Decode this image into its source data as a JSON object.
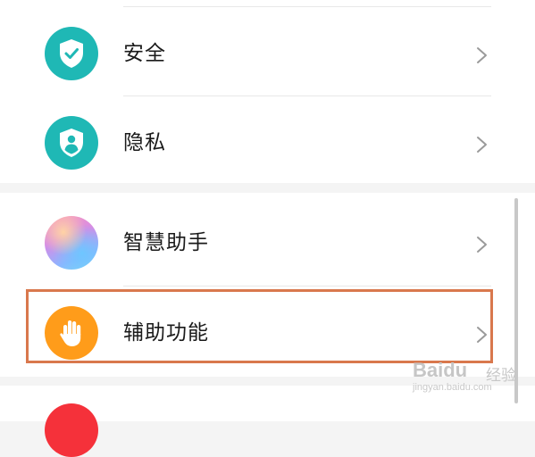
{
  "settings_list": [
    {
      "label": "安全",
      "icon": "shield-check-icon",
      "icon_color": "#1fb8b5"
    },
    {
      "label": "隐私",
      "icon": "shield-user-icon",
      "icon_color": "#1fb8b5"
    },
    {
      "label": "智慧助手",
      "icon": "assistant-orb-icon",
      "icon_color": "gradient"
    },
    {
      "label": "辅助功能",
      "icon": "hand-icon",
      "icon_color": "#ff9c1a",
      "highlighted": true
    }
  ],
  "highlight_color": "#d9784d",
  "watermark": {
    "brand": "Baidu",
    "suffix": "经验",
    "url": "jingyan.baidu.com"
  }
}
